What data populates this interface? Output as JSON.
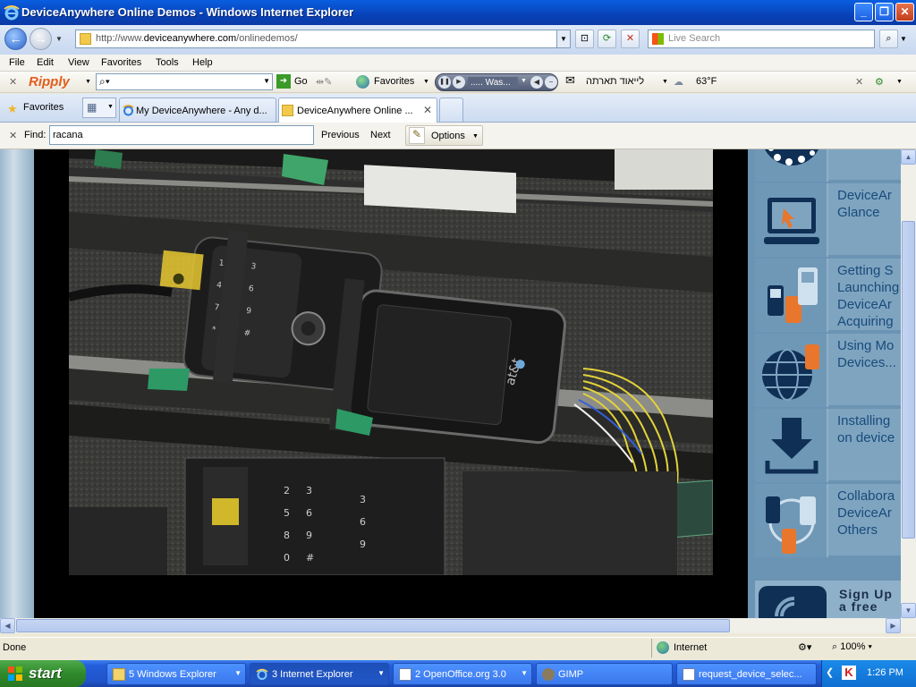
{
  "window": {
    "title": "DeviceAnywhere Online Demos - Windows Internet Explorer",
    "controls": {
      "minimize": "_",
      "maximize": "❐",
      "close": "✕"
    }
  },
  "address": {
    "url_prefix": "http://www.",
    "url_domain": "deviceanywhere.com",
    "url_path": "/onlinedemos/",
    "search_placeholder": "Live Search"
  },
  "menu": [
    "File",
    "Edit",
    "View",
    "Favorites",
    "Tools",
    "Help"
  ],
  "ripply": {
    "close": "✕",
    "brand": "Ripply",
    "go_label": "Go",
    "favorites_label": "Favorites",
    "track_label": "..... Was...",
    "hebrew_text": "לייאוד תארתה",
    "weather": "63°F"
  },
  "tabs_bar": {
    "favorites_label": "Favorites",
    "tabs": [
      {
        "label": "My DeviceAnywhere - Any d..."
      },
      {
        "label": "DeviceAnywhere Online ...",
        "close": "✕"
      }
    ]
  },
  "find": {
    "close": "✕",
    "label": "Find:",
    "value": "racana",
    "previous": "Previous",
    "next": "Next",
    "options": "Options"
  },
  "sidebar": {
    "items": [
      {
        "icon": "laptop-icon",
        "text": "DeviceAr\nGlance"
      },
      {
        "icon": "phones-icon",
        "text": "Getting S\nLaunching\nDeviceAr\nAcquiring"
      },
      {
        "icon": "globe-phone-icon",
        "text": "Using Mo\nDevices..."
      },
      {
        "icon": "download-icon",
        "text": "Installing\non device"
      },
      {
        "icon": "phones-cycle-icon",
        "text": "Collabora\nDeviceAr\nOthers"
      }
    ],
    "signup_text": "Sign Up\na free"
  },
  "status": {
    "text": "Done",
    "zone": "Internet",
    "zoom": "100%"
  },
  "taskbar": {
    "start": "start",
    "tasks": [
      {
        "label": "5 Windows Explorer"
      },
      {
        "label": "3 Internet Explorer"
      },
      {
        "label": "2 OpenOffice.org 3.0"
      },
      {
        "label": "GIMP"
      },
      {
        "label": "request_device_selec..."
      }
    ],
    "clock": "1:26 PM"
  },
  "colors": {
    "titlebar": "#0842b8",
    "sidebar": "#6b93b3",
    "sidebar_text": "#184b7a",
    "taskbar": "#245edb",
    "start_button": "#2f8a2c"
  }
}
